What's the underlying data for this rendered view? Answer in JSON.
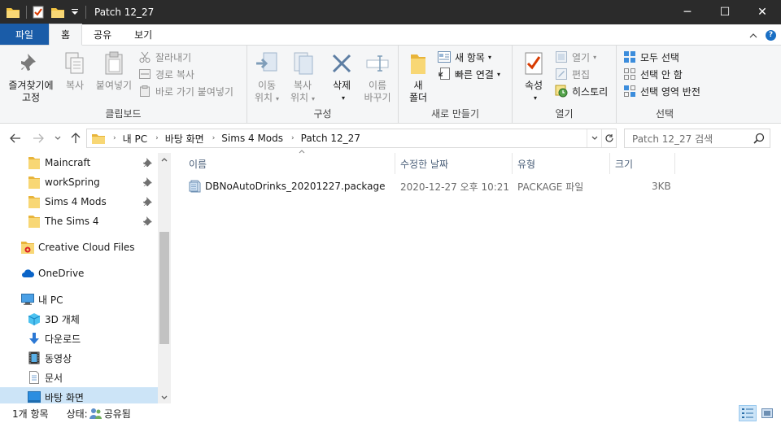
{
  "window": {
    "title": "Patch 12_27",
    "minimize": "─",
    "maximize": "☐",
    "close": "✕"
  },
  "tabs": {
    "file": "파일",
    "home": "홈",
    "share": "공유",
    "view": "보기"
  },
  "ribbon": {
    "clipboard": {
      "label": "클립보드",
      "pin_line1": "즐겨찾기에",
      "pin_line2": "고정",
      "copy": "복사",
      "paste": "붙여넣기",
      "cut": "잘라내기",
      "copy_path": "경로 복사",
      "paste_shortcut": "바로 가기 붙여넣기"
    },
    "organize": {
      "label": "구성",
      "move_line1": "이동",
      "move_line2": "위치",
      "copyto_line1": "복사",
      "copyto_line2": "위치",
      "delete": "삭제",
      "rename_line1": "이름",
      "rename_line2": "바꾸기"
    },
    "new": {
      "label": "새로 만들기",
      "folder_line1": "새",
      "folder_line2": "폴더",
      "new_item": "새 항목",
      "easy_access": "빠른 연결"
    },
    "open": {
      "label": "열기",
      "properties": "속성",
      "open": "열기",
      "edit": "편집",
      "history": "히스토리"
    },
    "select": {
      "label": "선택",
      "select_all": "모두 선택",
      "select_none": "선택 안 함",
      "invert": "선택 영역 반전"
    }
  },
  "address": {
    "breadcrumbs": [
      "내 PC",
      "바탕 화면",
      "Sims 4 Mods",
      "Patch 12_27"
    ],
    "search_placeholder": "Patch 12_27 검색"
  },
  "nav": {
    "quick_access": [
      {
        "label": "Maincraft"
      },
      {
        "label": "workSpring"
      },
      {
        "label": "Sims 4 Mods"
      },
      {
        "label": "The Sims 4"
      }
    ],
    "creative_cloud": "Creative Cloud Files",
    "onedrive": "OneDrive",
    "this_pc": "내 PC",
    "pc_items": [
      {
        "label": "3D 개체"
      },
      {
        "label": "다운로드"
      },
      {
        "label": "동영상"
      },
      {
        "label": "문서"
      },
      {
        "label": "바탕 화면"
      }
    ]
  },
  "columns": {
    "name": "이름",
    "modified": "수정한 날짜",
    "type": "유형",
    "size": "크기"
  },
  "files": [
    {
      "name": "DBNoAutoDrinks_20201227.package",
      "modified": "2020-12-27 오후 10:21",
      "type": "PACKAGE 파일",
      "size": "3KB"
    }
  ],
  "status": {
    "count": "1개 항목",
    "state_label": "상태:",
    "state_value": "공유됨"
  },
  "colors": {
    "accent": "#1a5ca8",
    "selection": "#cce4f7",
    "titlebar": "#2b2b2b"
  }
}
